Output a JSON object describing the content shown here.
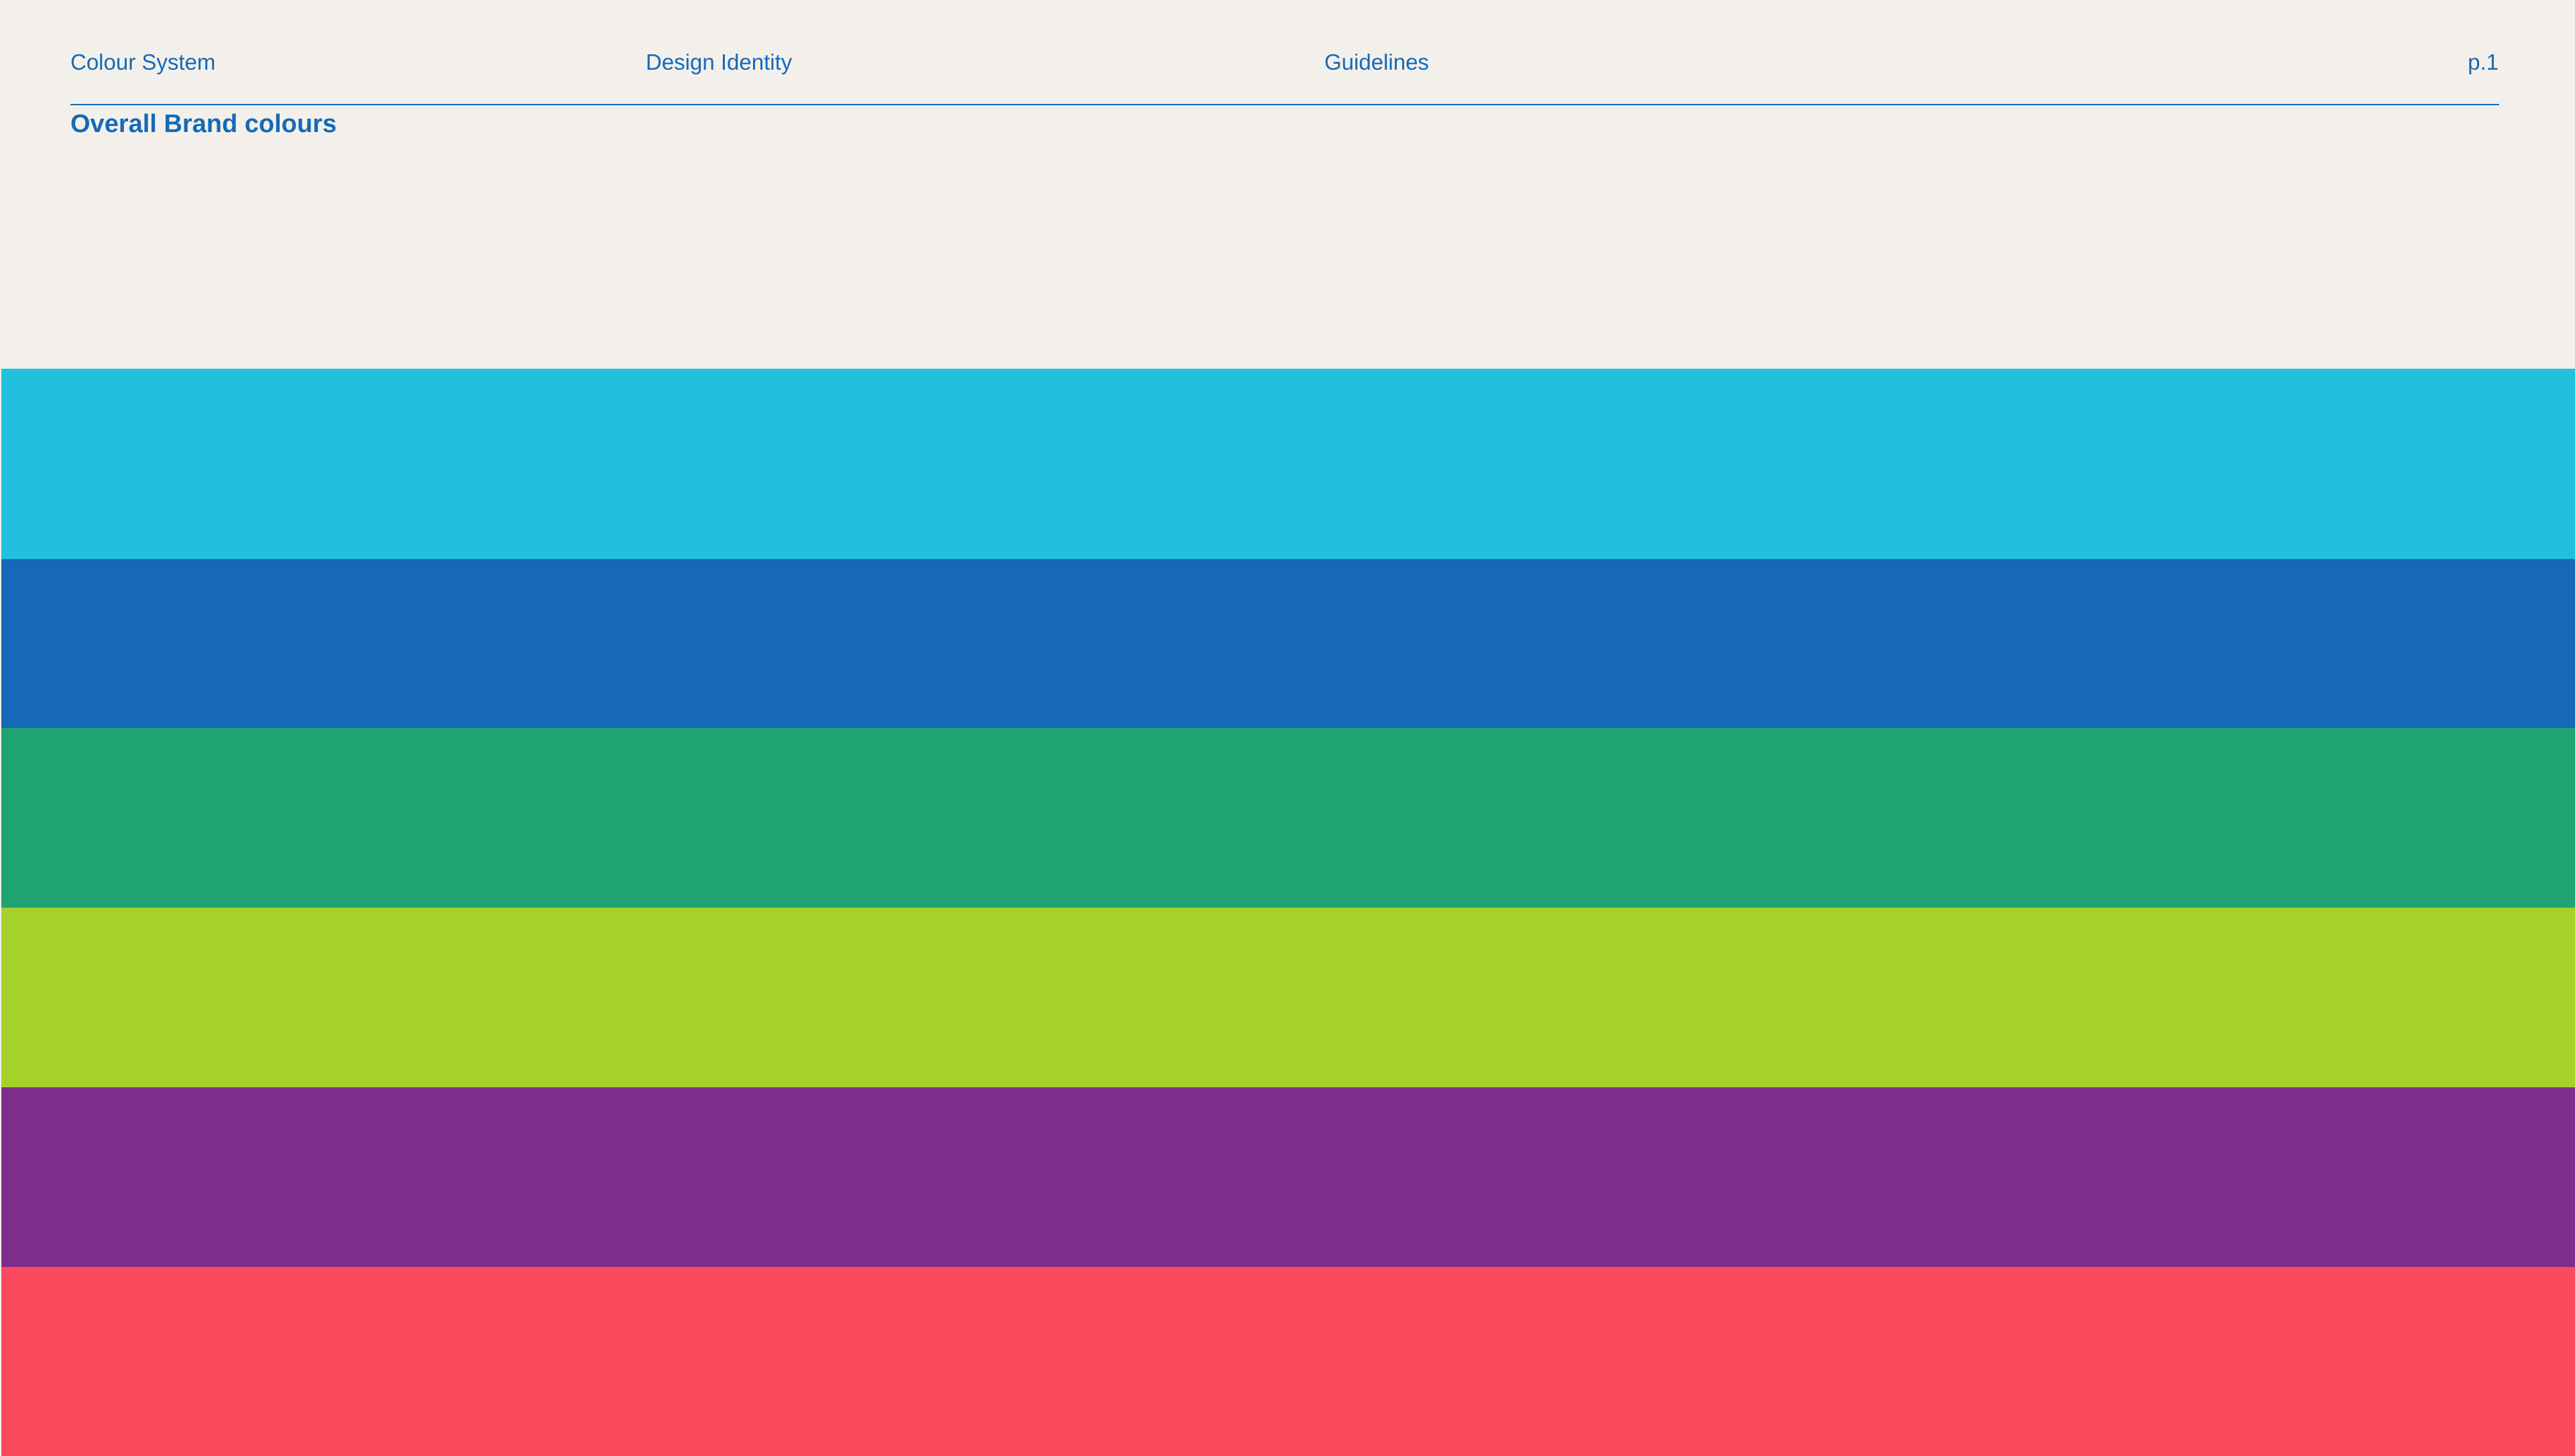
{
  "header": {
    "section": "Colour System",
    "project": "Design Identity",
    "document": "Guidelines",
    "page": "p.1"
  },
  "title": "Overall Brand colours",
  "colors": {
    "background": "#f3f0eb",
    "text": "#1669b7"
  },
  "brand_colours": [
    "#21c0dd",
    "#1669b7",
    "#1fa371",
    "#a6d12b",
    "#7d2d8b",
    "#fb4a5e"
  ]
}
